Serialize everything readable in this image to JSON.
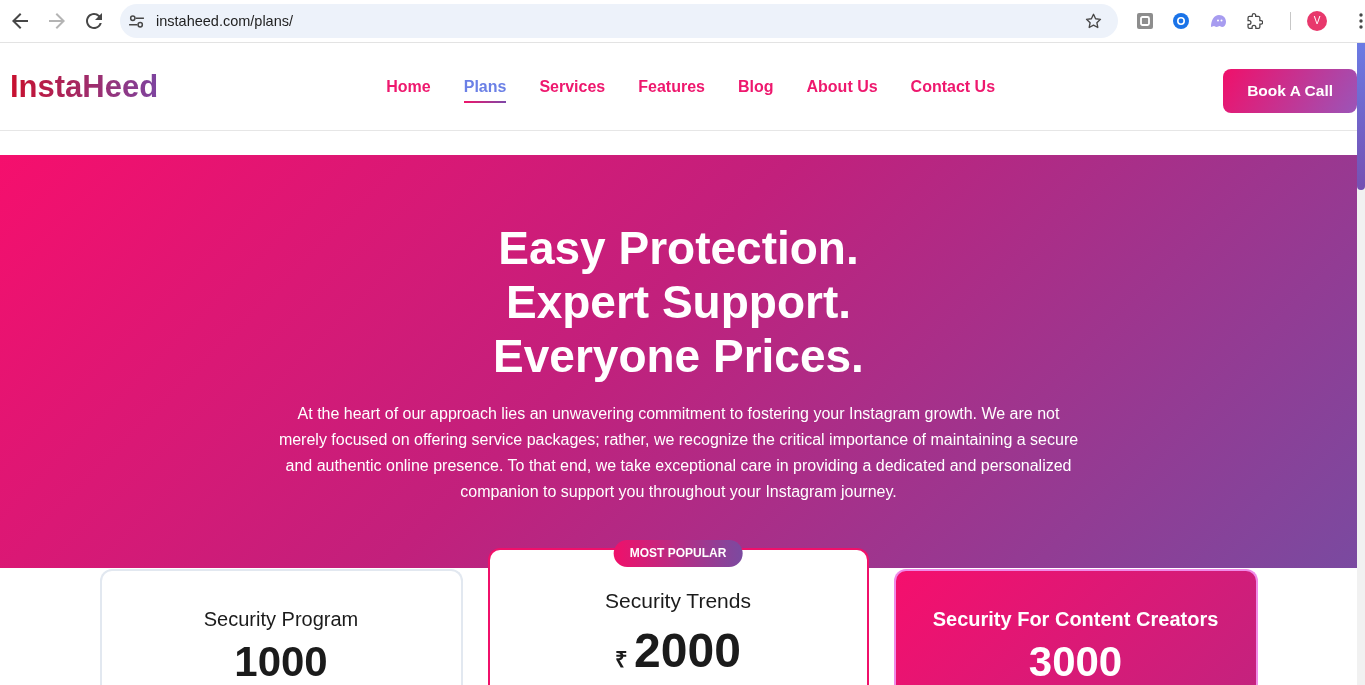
{
  "browser": {
    "nav_buttons": [
      {
        "kind": "back",
        "disabled": false
      },
      {
        "kind": "forward",
        "disabled": true
      },
      {
        "kind": "reload",
        "disabled": false
      }
    ],
    "url": "instaheed.com/plans/",
    "profile_initial": "V"
  },
  "header": {
    "logo": "InstaHeed",
    "nav": [
      {
        "label": "Home",
        "selected": false
      },
      {
        "label": "Plans",
        "selected": true
      },
      {
        "label": "Services",
        "selected": false
      },
      {
        "label": "Features",
        "selected": false
      },
      {
        "label": "Blog",
        "selected": false
      },
      {
        "label": "About Us",
        "selected": false
      },
      {
        "label": "Contact Us",
        "selected": false
      }
    ],
    "cta": "Book A Call"
  },
  "hero": {
    "title_lines": [
      "Easy Protection.",
      "Expert Support.",
      "Everyone Prices."
    ],
    "description": "At the heart of our approach lies an unwavering commitment to fostering your Instagram growth. We are not merely focused on offering service packages; rather, we recognize the critical importance of maintaining a secure and authentic online presence. To that end, we take exceptional care in providing a dedicated and personalized companion to support you throughout your Instagram journey."
  },
  "plans": [
    {
      "kind": "standard",
      "name": "Security Program",
      "price": "1000"
    },
    {
      "kind": "popular",
      "badge": "MOST POPULAR",
      "name": "Security Trends",
      "currency": "₹",
      "price": "2000"
    },
    {
      "kind": "featured",
      "name": "Security For Content Creators",
      "price": "3000"
    }
  ]
}
